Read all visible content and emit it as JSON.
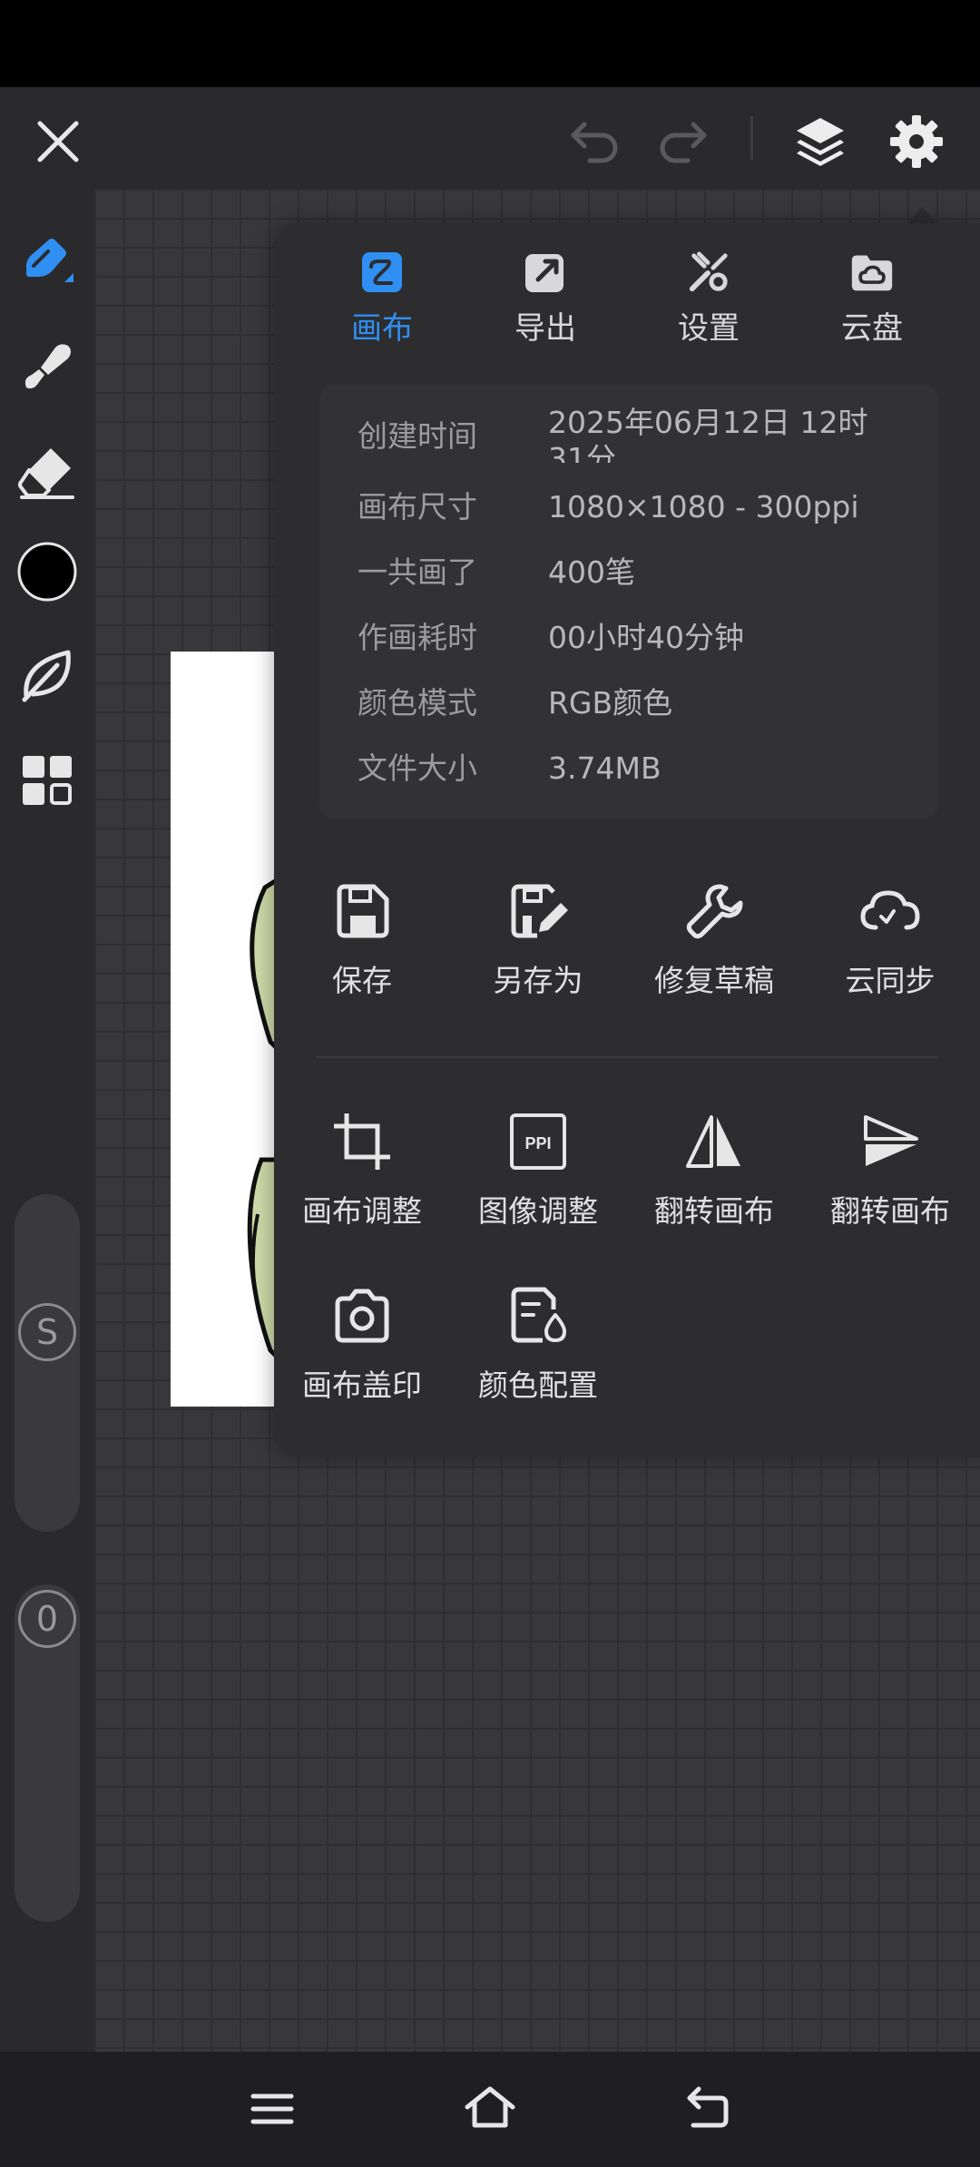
{
  "toolbar": {
    "close_icon": "close-icon",
    "undo_icon": "undo-icon",
    "redo_icon": "redo-icon",
    "layers_icon": "layers-icon",
    "settings_icon": "gear-icon"
  },
  "left_tools": [
    "pen-icon",
    "smudge-icon",
    "eraser-icon",
    "color-swatch",
    "leaf-icon",
    "grid-icon"
  ],
  "colors": {
    "accent": "#2f8ff2",
    "current_color": "#000000"
  },
  "sliders": [
    {
      "label": "S"
    },
    {
      "label": "0"
    }
  ],
  "panel": {
    "tabs": [
      {
        "label": "画布",
        "icon": "canvas-icon",
        "active": true
      },
      {
        "label": "导出",
        "icon": "export-icon",
        "active": false
      },
      {
        "label": "设置",
        "icon": "tools-icon",
        "active": false
      },
      {
        "label": "云盘",
        "icon": "cloud-drive-icon",
        "active": false
      }
    ],
    "info": [
      {
        "key": "创建时间",
        "value": "2025年06月12日 12时31分"
      },
      {
        "key": "画布尺寸",
        "value": "1080×1080 - 300ppi"
      },
      {
        "key": "一共画了",
        "value": "400笔"
      },
      {
        "key": "作画耗时",
        "value": "00小时40分钟"
      },
      {
        "key": "颜色模式",
        "value": "RGB颜色"
      },
      {
        "key": "文件大小",
        "value": "3.74MB"
      }
    ],
    "actions_row1": [
      {
        "label": "保存",
        "icon": "save-icon"
      },
      {
        "label": "另存为",
        "icon": "save-as-icon"
      },
      {
        "label": "修复草稿",
        "icon": "wrench-icon"
      },
      {
        "label": "云同步",
        "icon": "cloud-sync-icon"
      }
    ],
    "actions_row2": [
      {
        "label": "画布调整",
        "icon": "crop-icon"
      },
      {
        "label": "图像调整",
        "icon": "ppi-icon"
      },
      {
        "label": "翻转画布",
        "icon": "flip-horizontal-icon"
      },
      {
        "label": "翻转画布",
        "icon": "flip-vertical-icon"
      }
    ],
    "actions_row3": [
      {
        "label": "画布盖印",
        "icon": "camera-icon"
      },
      {
        "label": "颜色配置",
        "icon": "color-profile-icon"
      }
    ]
  },
  "nav": {
    "menu_icon": "menu-icon",
    "home_icon": "home-icon",
    "back_icon": "back-icon"
  }
}
